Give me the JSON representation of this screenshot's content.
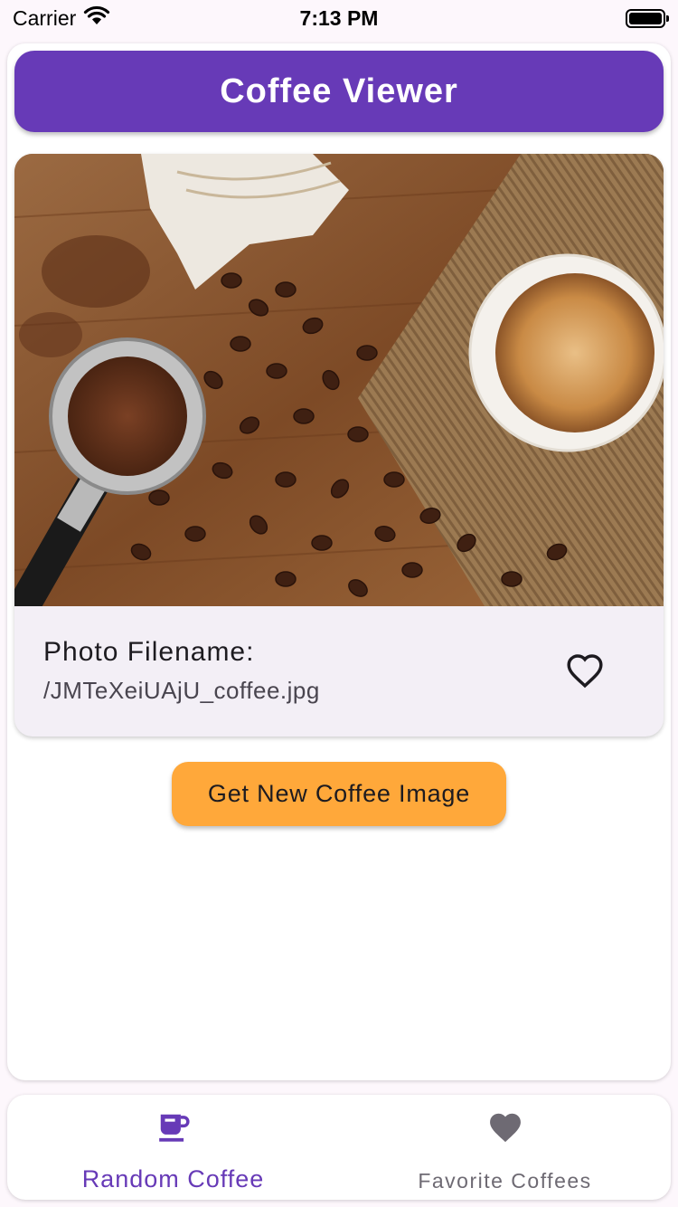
{
  "status_bar": {
    "carrier": "Carrier",
    "time": "7:13 PM"
  },
  "app_bar": {
    "title": "Coffee Viewer",
    "color": "#673ab7"
  },
  "photo_card": {
    "label": "Photo Filename:",
    "filename": "/JMTeXeiUAjU_coffee.jpg",
    "favorite_icon": "heart-outline-icon"
  },
  "actions": {
    "new_image_label": "Get New Coffee Image",
    "button_color": "#ffa83a"
  },
  "bottom_nav": {
    "items": [
      {
        "label": "Random Coffee",
        "icon": "coffee-cup-icon",
        "active": true
      },
      {
        "label": "Favorite Coffees",
        "icon": "heart-icon",
        "active": false
      }
    ]
  }
}
